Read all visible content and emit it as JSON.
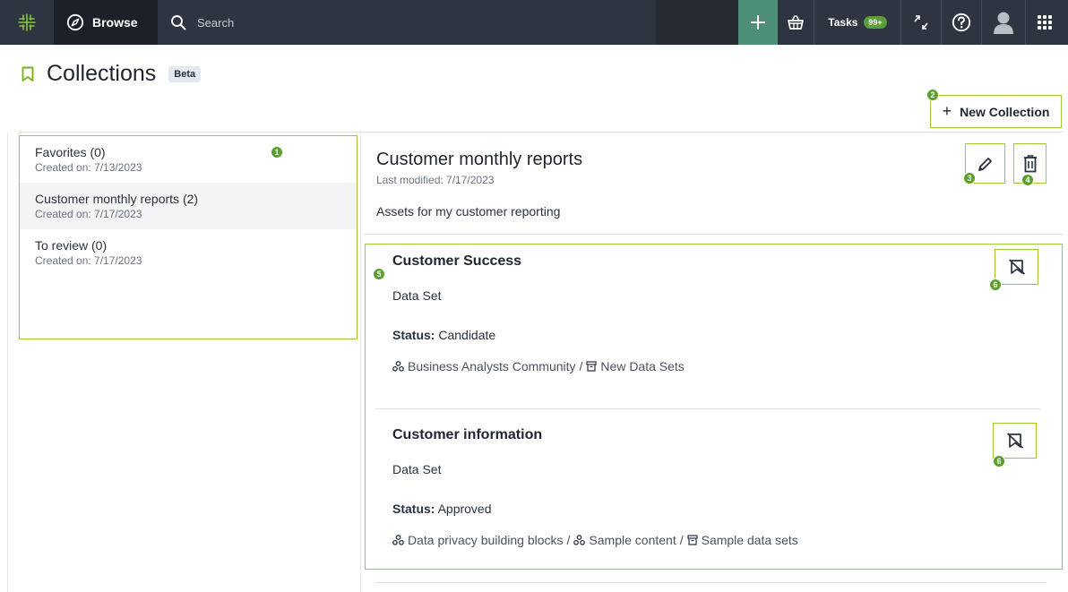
{
  "nav": {
    "browse_label": "Browse",
    "search_placeholder": "Search",
    "tasks_label": "Tasks",
    "tasks_count": "99+"
  },
  "page": {
    "title": "Collections",
    "beta_badge": "Beta",
    "new_collection_label": "New Collection"
  },
  "collections": [
    {
      "name": "Favorites (0)",
      "created": "Created on: 7/13/2023"
    },
    {
      "name": "Customer monthly reports (2)",
      "created": "Created on: 7/17/2023"
    },
    {
      "name": "To review (0)",
      "created": "Created on: 7/17/2023"
    }
  ],
  "detail": {
    "title": "Customer monthly reports",
    "modified": "Last modified: 7/17/2023",
    "description": "Assets for my customer reporting"
  },
  "assets": [
    {
      "name": "Customer Success",
      "type": "Data Set",
      "status_label": "Status:",
      "status_value": "Candidate",
      "path": [
        {
          "icon": "community-icon",
          "text": "Business Analysts Community"
        },
        {
          "sep": "/"
        },
        {
          "icon": "domain-icon",
          "text": "New Data Sets"
        }
      ]
    },
    {
      "name": "Customer information",
      "type": "Data Set",
      "status_label": "Status:",
      "status_value": "Approved",
      "path": [
        {
          "icon": "community-icon",
          "text": "Data privacy building blocks"
        },
        {
          "sep": "/"
        },
        {
          "icon": "community-icon",
          "text": "Sample content"
        },
        {
          "sep": "/"
        },
        {
          "icon": "domain-icon",
          "text": "Sample data sets"
        }
      ]
    }
  ],
  "markers": [
    "1",
    "2",
    "3",
    "4",
    "5",
    "6",
    "6"
  ],
  "colors": {
    "nav_bg": "#2f3540",
    "accent_green": "#4d8f79",
    "highlight_border": "#9acd32",
    "marker_green": "#5aa02c"
  }
}
